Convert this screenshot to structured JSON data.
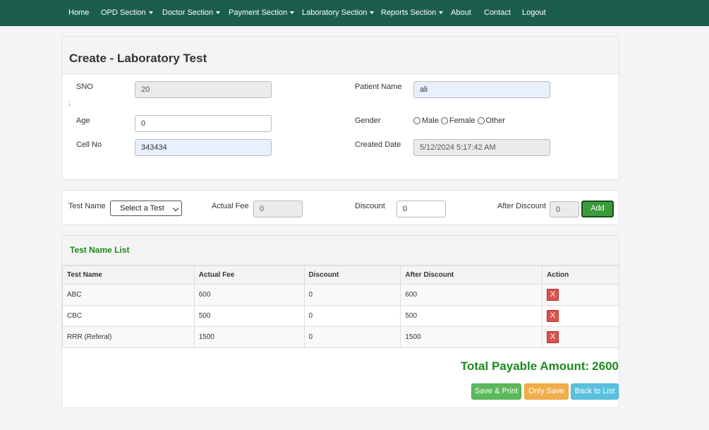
{
  "nav": {
    "items": [
      {
        "label": "Home",
        "dropdown": false
      },
      {
        "label": "OPD Section",
        "dropdown": true
      },
      {
        "label": "Doctor Section",
        "dropdown": true
      },
      {
        "label": "Payment Section",
        "dropdown": true
      },
      {
        "label": "Laboratory Section",
        "dropdown": true
      },
      {
        "label": "Reports Section",
        "dropdown": true
      },
      {
        "label": "About",
        "dropdown": false
      },
      {
        "label": "Contact",
        "dropdown": false
      },
      {
        "label": "Logout",
        "dropdown": false
      }
    ]
  },
  "form": {
    "title": "Create - Laboratory Test",
    "sno": {
      "label": "SNO",
      "value": "20"
    },
    "separator": ";",
    "patient_name": {
      "label": "Patient Name",
      "value": "ali"
    },
    "age": {
      "label": "Age",
      "value": "0"
    },
    "gender": {
      "label": "Gender",
      "options": [
        "Male",
        "Female",
        "Other"
      ],
      "selected": ""
    },
    "cell_no": {
      "label": "Cell No",
      "value": "343434"
    },
    "created_date": {
      "label": "Created Date",
      "value": "5/12/2024 5:17:42 AM"
    }
  },
  "test_entry": {
    "test_name_label": "Test Name",
    "test_select": {
      "selected": "Select a Test"
    },
    "actual_fee_label": "Actual Fee",
    "actual_fee_value": "0",
    "discount_label": "Discount",
    "discount_value": "0",
    "after_discount_label": "After Discount",
    "after_discount_value": "0",
    "add_label": "Add"
  },
  "test_list": {
    "title": "Test Name List",
    "columns": [
      "Test Name",
      "Actual Fee",
      "Discount",
      "After Discount",
      "Action"
    ],
    "rows": [
      {
        "test_name": "ABC",
        "actual_fee": "600",
        "discount": "0",
        "after_discount": "600",
        "action": "X"
      },
      {
        "test_name": "CBC",
        "actual_fee": "500",
        "discount": "0",
        "after_discount": "500",
        "action": "X"
      },
      {
        "test_name": "RRR (Referal)",
        "actual_fee": "1500",
        "discount": "0",
        "after_discount": "1500",
        "action": "X"
      }
    ],
    "total_label": "Total Payable Amount:",
    "total_value": "2600"
  },
  "actions": {
    "save_print": "Save & Print",
    "only_save": "Only Save",
    "back_to_list": "Back to List"
  },
  "colors": {
    "navbar": "#1b5e4e",
    "accent_green": "#1c8a1c",
    "btn_success": "#5cb85c",
    "btn_warning": "#f0ad4e",
    "btn_info": "#5bc0de",
    "btn_danger": "#d9534f"
  }
}
